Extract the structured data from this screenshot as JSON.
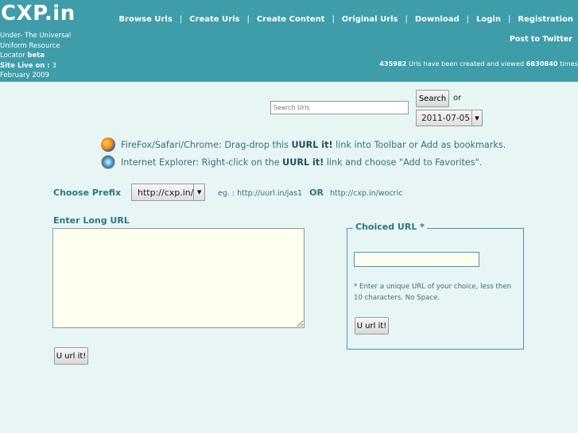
{
  "header": {
    "logo": "CXP.in",
    "tagline_line1": "Under- The Universal",
    "tagline_line2": "Uniform Resource",
    "tagline_line3": "Locator",
    "tagline_beta": "beta",
    "site_live_label": "Site Live on :",
    "site_live_day": "3",
    "site_live_date": "February 2009",
    "nav": [
      "Browse Urls",
      "Create Urls",
      "Create Content",
      "Original Urls",
      "Download",
      "Login",
      "Registration"
    ],
    "nav_separator": "|",
    "post_to_twitter": "Post to Twitter",
    "stats_count": "435982",
    "stats_text": " Urls have been created and viewed ",
    "stats_views": "6830840",
    "stats_suffix": " times"
  },
  "search": {
    "placeholder": "Search Urls",
    "button_label": "Search",
    "or_label": "or",
    "date_value": "2011-07-05"
  },
  "info": {
    "firefox_prefix": "FireFox/Safari/Chrome: Drag-drop this ",
    "firefox_link": "UURL it!",
    "firefox_suffix": " link into Toolbar or Add as bookmarks.",
    "ie_prefix": "Internet Explorer: Right-click on the ",
    "ie_link": "UURL it!",
    "ie_suffix": " link and choose \"Add to Favorites\"."
  },
  "prefix": {
    "label": "Choose Prefix",
    "selected": "http://cxp.in/",
    "example_label": "eg. : http://uurl.in/jas1",
    "or_label": "OR",
    "example2": "http://cxp.in/wocric"
  },
  "long_url": {
    "label": "Enter Long URL",
    "submit_label": "U url it!"
  },
  "choiced_url": {
    "legend": "Choiced URL *",
    "note": "* Enter a unique URL of your choice, less then 10 characters. No Space.",
    "submit_label": "U url it!"
  },
  "colors": {
    "header_bg": "#3e9da9",
    "page_bg": "#e8f5f5",
    "accent_text": "#2c7680"
  }
}
